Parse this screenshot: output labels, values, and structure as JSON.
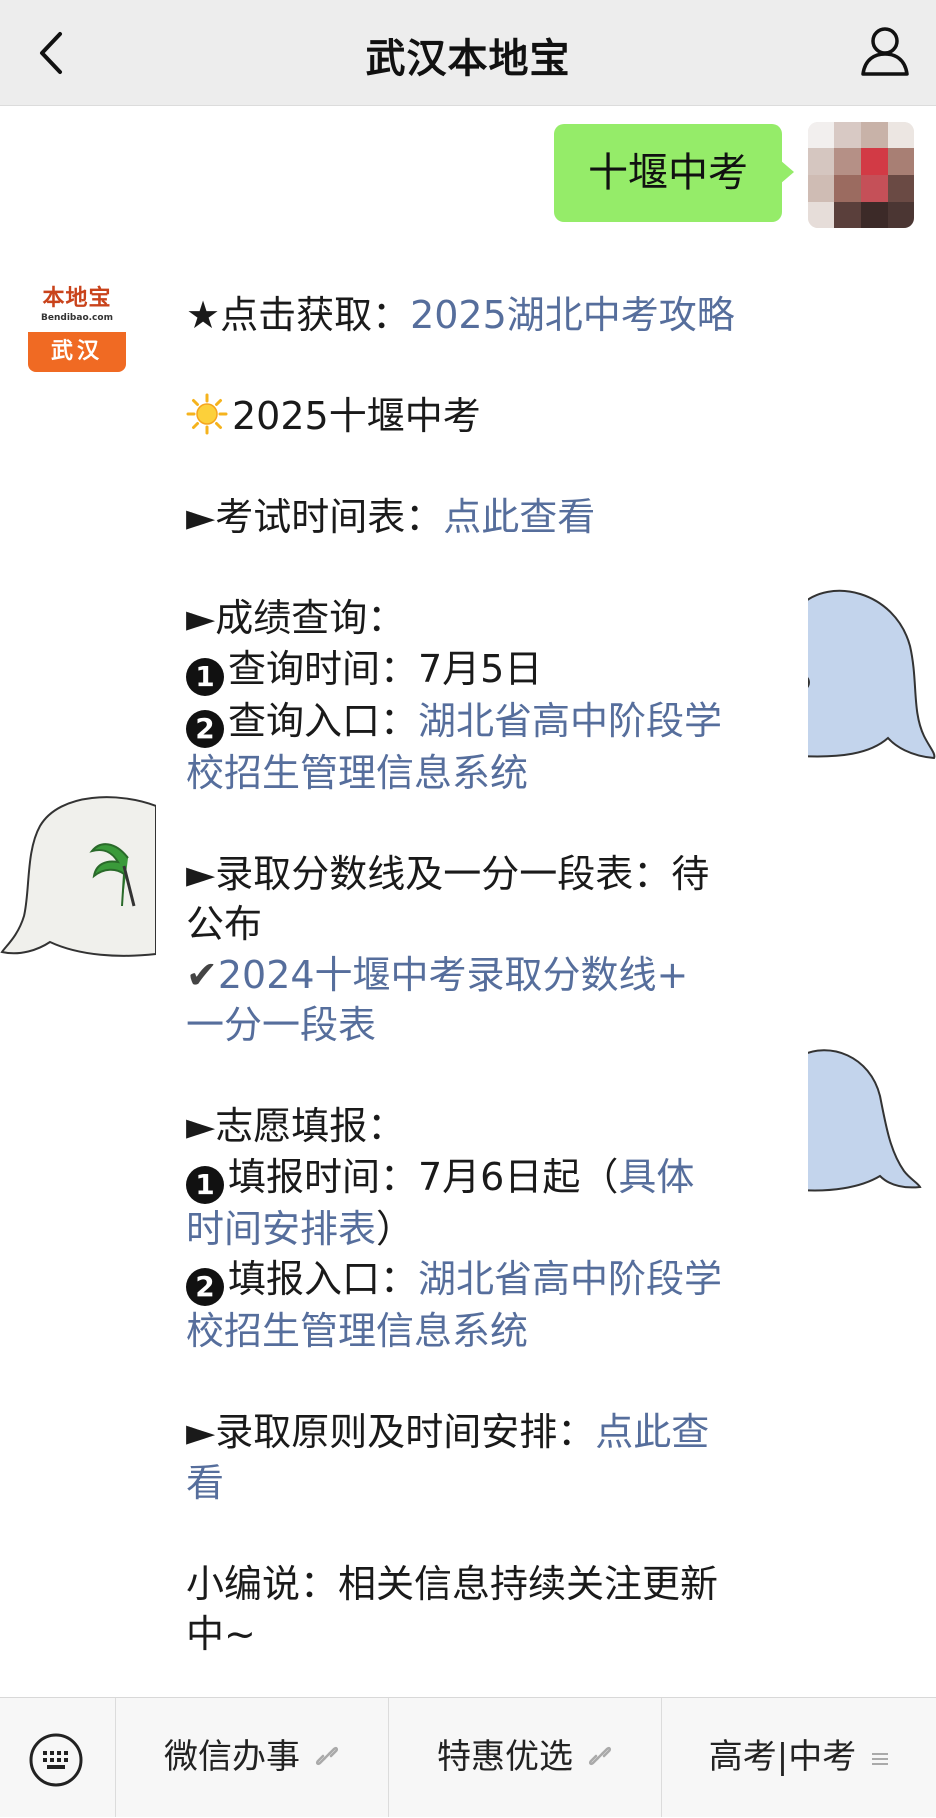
{
  "header": {
    "title": "武汉本地宝",
    "back_icon": "chevron-left-icon",
    "profile_icon": "person-icon"
  },
  "outgoing_message": {
    "text": "十堰中考"
  },
  "bot": {
    "avatar_logo_text": "本地宝",
    "avatar_logo_url": "Bendibao.com",
    "avatar_city": "武汉"
  },
  "message": {
    "p1": {
      "prefix": "★点击获取：",
      "link": "2025湖北中考攻略"
    },
    "p2": {
      "text": "2025十堰中考"
    },
    "p3": {
      "prefix": "►考试时间表：",
      "link": "点此查看"
    },
    "p4": {
      "heading": "►成绩查询：",
      "item1_num": "1",
      "item1_text": "查询时间：7月5日",
      "item2_num": "2",
      "item2_prefix": "查询入口：",
      "item2_link_line1": "湖北省高中阶段学",
      "item2_link_line2": "校招生管理信息系统"
    },
    "p5": {
      "line1": "►录取分数线及一分一段表：待",
      "line2": "公布",
      "check": "✔",
      "link_line1": "2024十堰中考录取分数线+",
      "link_line2": "一分一段表"
    },
    "p6": {
      "heading": "►志愿填报：",
      "item1_num": "1",
      "item1_text": "填报时间：7月6日起（",
      "item1_link1": "具体",
      "item1_link2": "时间安排表",
      "item1_close": "）",
      "item2_num": "2",
      "item2_prefix": "填报入口：",
      "item2_link_line1": "湖北省高中阶段学",
      "item2_link_line2": "校招生管理信息系统"
    },
    "p7": {
      "prefix": "►录取原则及时间安排：",
      "link1": "点此查",
      "link2": "看"
    },
    "p8": {
      "line1": "小编说：相关信息持续关注更新",
      "line2": "中~"
    }
  },
  "bottom_menu": {
    "keyboard_icon": "keyboard-icon",
    "items": [
      {
        "label": "微信办事",
        "icon": "link-icon"
      },
      {
        "label": "特惠优选",
        "icon": "link-icon"
      },
      {
        "label": "高考|中考",
        "icon": "menu-lines-icon"
      }
    ]
  },
  "colors": {
    "link": "#566e9c",
    "outgoing_bubble": "#95ec69",
    "header_bg": "#ededed",
    "brand_orange": "#f06a23"
  }
}
